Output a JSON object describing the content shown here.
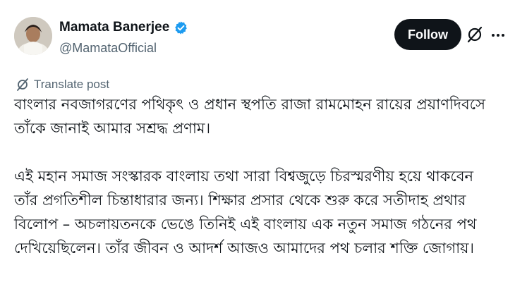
{
  "author": {
    "display_name": "Mamata Banerjee",
    "handle": "@MamataOfficial",
    "verified": true,
    "verified_color": "#1d9bf0",
    "avatar": "profile-photo"
  },
  "actions": {
    "follow_label": "Follow",
    "grok_icon": "grok-slash-icon",
    "more_icon": "more-horizontal-icon"
  },
  "translate": {
    "label": "Translate post",
    "icon": "grok-slash-icon"
  },
  "post": {
    "paragraph1": [
      "বাংলার নবজাগরণের পথিকৃৎ ও প্রধান স্থপতি রাজা রামমোহন রায়ের প্রয়াণদিবসে",
      "তাঁকে জানাই আমার সশ্রদ্ধ প্রণাম।"
    ],
    "paragraph2": [
      "এই মহান সমাজ সংস্কারক বাংলায় তথা সারা বিশ্বজুড়ে চিরস্মরণীয় হয়ে থাকবেন",
      "তাঁর প্রগতিশীল চিন্তাধারার জন্য। শিক্ষার প্রসার থেকে শুরু করে সতীদাহ প্রথার",
      "বিলোপ – অচলায়তনকে ভেঙে তিনিই এই বাংলায় এক নতুন সমাজ গঠনের পথ",
      "দেখিয়েছিলেন। তাঁর জীবন ও আদর্শ আজও আমাদের পথ চলার শক্তি জোগায়।"
    ]
  },
  "colors": {
    "text": "#0f1419",
    "muted": "#536471",
    "follow_bg": "#0f1419",
    "follow_text": "#ffffff"
  }
}
